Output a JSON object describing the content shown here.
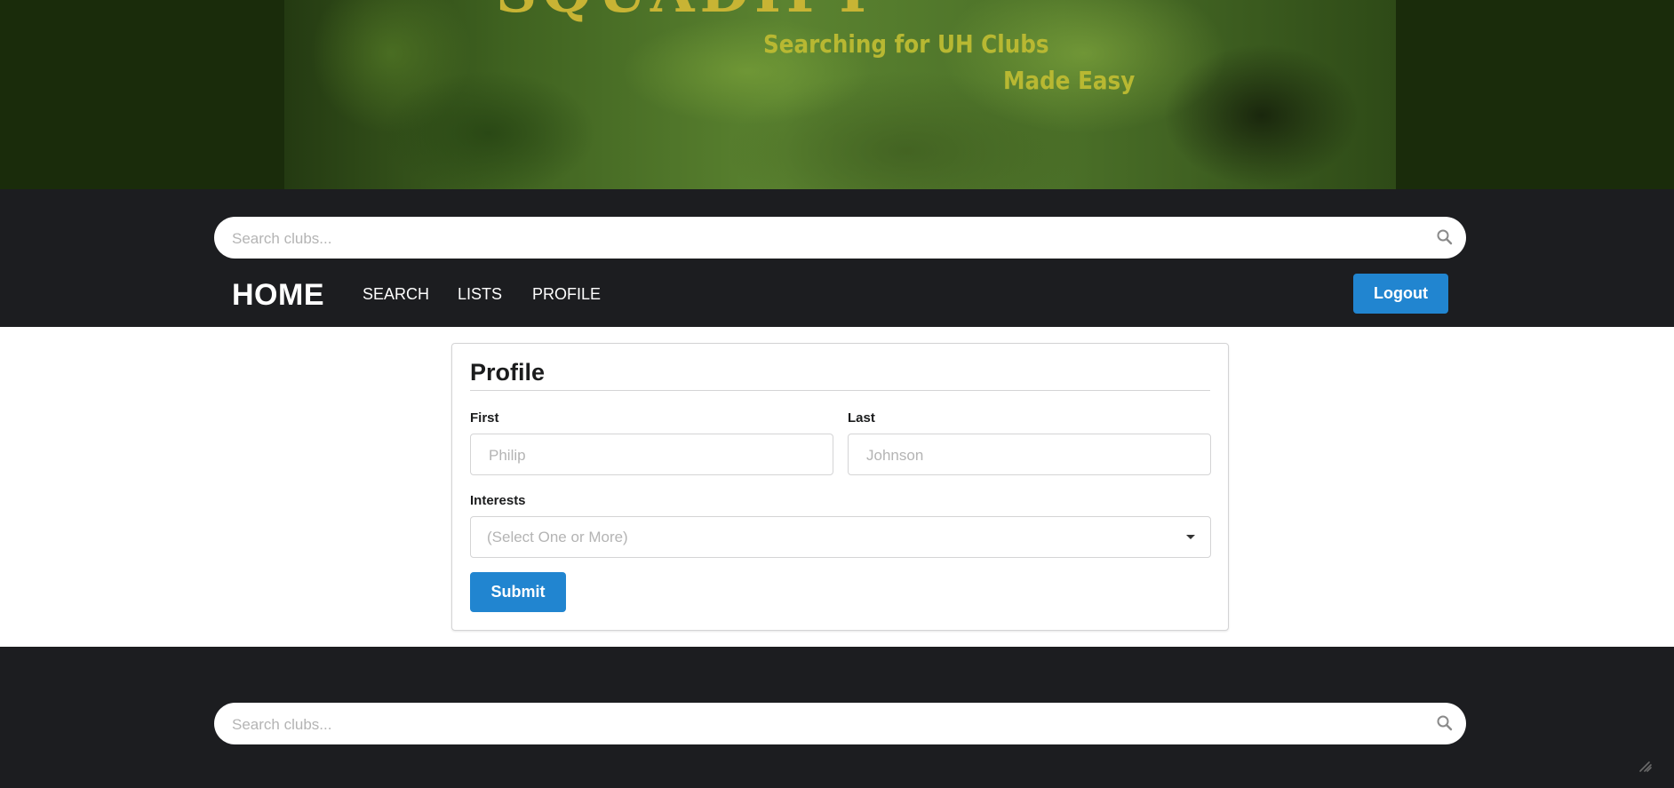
{
  "banner": {
    "logo_text": "SQUADIFY",
    "tagline_line1": "Searching for UH Clubs",
    "tagline_line2": "Made Easy"
  },
  "search": {
    "placeholder": "Search clubs..."
  },
  "nav": {
    "home": "HOME",
    "search": "SEARCH",
    "lists": "LISTS",
    "profile": "PROFILE",
    "logout": "Logout"
  },
  "profile_form": {
    "title": "Profile",
    "first_label": "First",
    "first_placeholder": "Philip",
    "last_label": "Last",
    "last_placeholder": "Johnson",
    "interests_label": "Interests",
    "interests_placeholder": "(Select One or More)",
    "submit": "Submit"
  },
  "footer": {
    "search_placeholder": "Search clubs..."
  },
  "colors": {
    "nav_bg": "#1c1d20",
    "primary_button": "#2185d0",
    "tagline": "#b8b832"
  },
  "icons": {
    "search": "search-icon",
    "dropdown": "caret-down-icon",
    "corner": "edit-icon"
  }
}
